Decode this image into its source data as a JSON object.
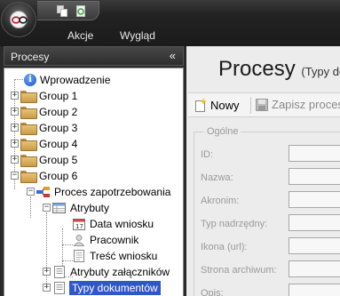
{
  "menu": {
    "akcje": "Akcje",
    "wyglad": "Wygląd"
  },
  "sidebar": {
    "title": "Procesy",
    "collapse_glyph": "«",
    "tree": {
      "intro": "Wprowadzenie",
      "groups": [
        "Group 1",
        "Group 2",
        "Group 3",
        "Group 4",
        "Group 5",
        "Group 6"
      ],
      "process": "Proces zapotrzebowania",
      "attributes": "Atrybuty",
      "attr_items": [
        "Data wniosku",
        "Pracownik",
        "Treść wniosku"
      ],
      "attachments": "Atrybuty załączników",
      "doc_types": "Typy dokumentów"
    }
  },
  "main": {
    "title": "Procesy",
    "subtitle": "(Typy do",
    "toolbar": {
      "new_label": "Nowy",
      "save_label": "Zapisz proces"
    },
    "form": {
      "group_label": "Ogólne",
      "fields": [
        "ID:",
        "Nazwa:",
        "Akronim:",
        "Typ nadrzędny:",
        "Ikona (url):",
        "Strona archiwum:",
        "Opis:"
      ]
    }
  },
  "colors": {
    "selection": "#2f57c8",
    "folder": "#e8c27a",
    "dark_chrome": "#2a2a2a"
  }
}
